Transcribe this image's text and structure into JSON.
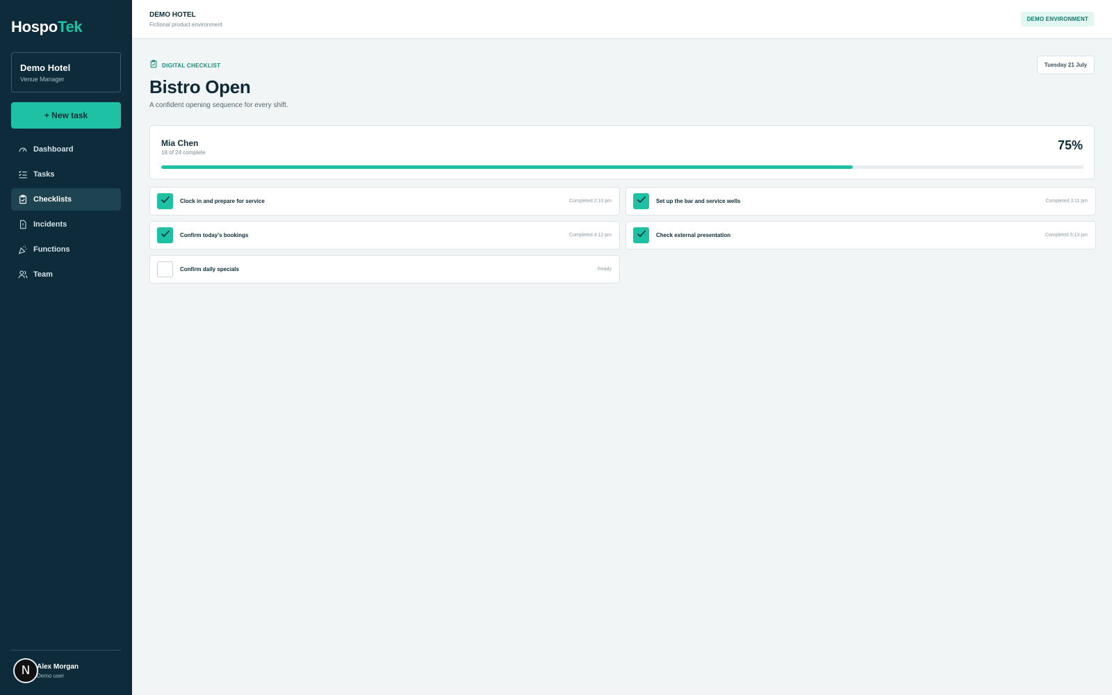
{
  "sidebar": {
    "logo_part1": "Hospo",
    "logo_part2": "Tek",
    "venue": {
      "name": "Demo Hotel",
      "role": "Venue Manager"
    },
    "new_task_label": "+ New task",
    "nav": [
      {
        "label": "Dashboard",
        "icon": "gauge-icon",
        "active": false
      },
      {
        "label": "Tasks",
        "icon": "task-list-icon",
        "active": false
      },
      {
        "label": "Checklists",
        "icon": "clipboard-check-icon",
        "active": true
      },
      {
        "label": "Incidents",
        "icon": "alert-file-icon",
        "active": false
      },
      {
        "label": "Functions",
        "icon": "party-popper-icon",
        "active": false
      },
      {
        "label": "Team",
        "icon": "users-icon",
        "active": false
      }
    ],
    "user": {
      "avatar_letter": "N",
      "name": "Alex Morgan",
      "role": "Demo user"
    }
  },
  "header": {
    "title": "DEMO HOTEL",
    "subtitle": "Fictional product environment",
    "badge": "DEMO ENVIRONMENT"
  },
  "main": {
    "eyebrow": "DIGITAL CHECKLIST",
    "date": "Tuesday 21 July",
    "title": "Bistro Open",
    "subtitle": "A confident opening sequence for every shift.",
    "progress": {
      "name": "Mia Chen",
      "count_text": "18 of 24 complete",
      "percent_text": "75%",
      "percent": 75
    },
    "tasks": [
      {
        "label": "Clock in and prepare for service",
        "status": "Completed 2:10 pm",
        "checked": true
      },
      {
        "label": "Set up the bar and service wells",
        "status": "Completed 3:11 pm",
        "checked": true
      },
      {
        "label": "Confirm today's bookings",
        "status": "Completed 4:12 pm",
        "checked": true
      },
      {
        "label": "Check external presentation",
        "status": "Completed 5:13 pm",
        "checked": true
      },
      {
        "label": "Confirm daily specials",
        "status": "Ready",
        "checked": false
      }
    ]
  },
  "colors": {
    "sidebar_bg": "#0d2b3a",
    "accent": "#1fc1a5",
    "page_bg": "#f2f5f6"
  }
}
